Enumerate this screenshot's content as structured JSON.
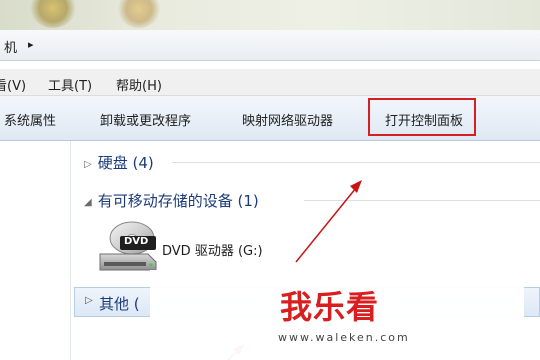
{
  "window": {
    "address_text": "机",
    "address_arrow": "▸"
  },
  "menu": {
    "items": [
      "看(V)",
      "工具(T)",
      "帮助(H)"
    ]
  },
  "toolbar": {
    "buttons": [
      "系统属性",
      "卸载或更改程序",
      "映射网络驱动器",
      "打开控制面板"
    ],
    "highlight_color": "#d42020"
  },
  "content": {
    "groups": [
      {
        "icon": "collapsed-triangle-icon",
        "label": "硬盘 (4)"
      },
      {
        "icon": "expanded-triangle-icon",
        "label": "有可移动存储的设备 (1)"
      }
    ],
    "drive": {
      "icon": "dvd-drive-icon",
      "badge": "DVD",
      "label": "DVD 驱动器 (G:)"
    },
    "other_group": {
      "icon": "collapsed-triangle-icon",
      "label": "其他 ("
    }
  },
  "watermark": {
    "logo": "我乐看",
    "url": "www.waleken.com"
  },
  "annotation": {
    "arrow_color": "#c81414"
  }
}
